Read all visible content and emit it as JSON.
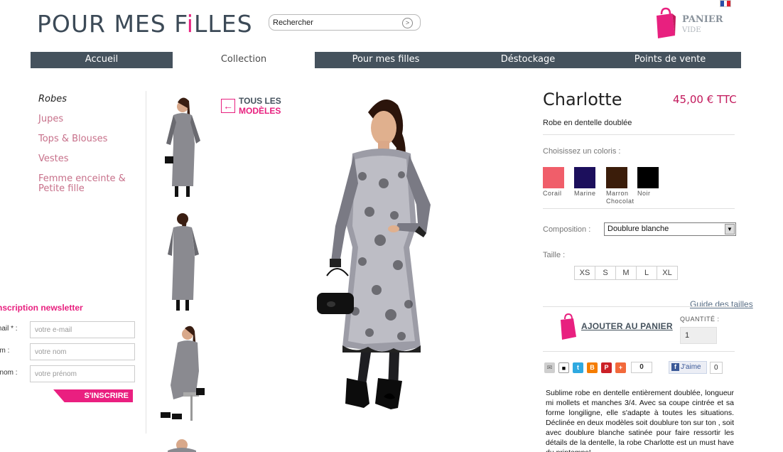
{
  "header": {
    "logo_part1": "POUR MES F",
    "logo_i": "i",
    "logo_part2": "LLES",
    "search_placeholder": "Rechercher",
    "cart_label": "PANIER",
    "cart_status": "VIDE",
    "flag": "fr-flag-icon"
  },
  "nav": {
    "items": [
      "Accueil",
      "Collection",
      "Pour mes filles",
      "Déstockage",
      "Points de vente"
    ],
    "active": "Collection"
  },
  "sidebar": {
    "categories": [
      "Robes",
      "Jupes",
      "Tops & Blouses",
      "Vestes",
      "Femme enceinte & Petite fille"
    ]
  },
  "newsletter": {
    "title": "nscription newsletter",
    "email_label": "mail * :",
    "email_placeholder": "votre e-mail",
    "name_label": "om :",
    "name_placeholder": "votre nom",
    "firstname_label": "énom :",
    "firstname_placeholder": "votre prénom",
    "submit": "S'INSCRIRE"
  },
  "gallery": {
    "back_line1": "TOUS LES",
    "back_line2": "MODÈLES"
  },
  "product": {
    "name": "Charlotte",
    "price": "45,00 € TTC",
    "subtitle": "Robe en dentelle doublée",
    "colors_label": "Choisissez un coloris :",
    "colors": [
      {
        "label": "Corail",
        "hex": "#f05e6a"
      },
      {
        "label": "Marine",
        "hex": "#1c0f5c"
      },
      {
        "label": "Marron Chocolat",
        "hex": "#3b1d0a"
      },
      {
        "label": "Noir",
        "hex": "#000000"
      }
    ],
    "composition_label": "Composition :",
    "composition_value": "Doublure blanche",
    "size_label": "Taille :",
    "sizes": [
      "XS",
      "S",
      "M",
      "L",
      "XL"
    ],
    "size_guide": "Guide des tailles",
    "add_to_cart": "AJOUTER AU PANIER",
    "quantity_label": "QUANTITÉ :",
    "quantity": "1",
    "share_count": "0",
    "like_label": "J'aime",
    "like_count": "0",
    "description": "Sublime robe en dentelle entièrement doublée, longueur mi mollets et manches 3/4. Avec sa coupe cintrée et sa forme longiligne, elle s'adapte à toutes les situations. Déclinée en deux modèles soit doublure ton sur ton , soit avec doublure blanche satinée pour faire ressortir les détails de la dentelle, la robe Charlotte est un must have du printemps!"
  },
  "colors": {
    "brand_pink": "#e8207f",
    "nav_bg": "#45525d"
  }
}
